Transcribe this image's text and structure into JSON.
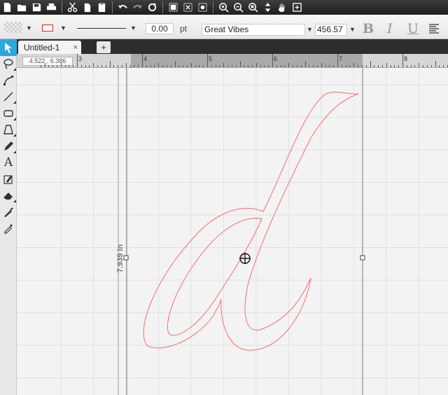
{
  "toolbar": {
    "icons": [
      "new-file",
      "open-folder",
      "save",
      "print",
      "cut",
      "copy",
      "paste",
      "undo",
      "redo",
      "refresh",
      "group",
      "ungroup",
      "select-all",
      "zoom-in",
      "zoom-out",
      "zoom-fit",
      "move",
      "pan-hand",
      "fit-page"
    ]
  },
  "properties": {
    "stroke_width": "0.00",
    "stroke_unit": "pt",
    "font_name": "Great Vibes",
    "font_size": "456.57",
    "bold": "B",
    "italic": "I",
    "underline": "U",
    "stroke_color": "#dd2222"
  },
  "tabs": {
    "doc_title": "Untitled-1",
    "close": "×",
    "add": "+"
  },
  "ruler": {
    "coords": "4.522 , 6.386",
    "labels": [
      "3",
      "4",
      "5",
      "6",
      "7",
      "8"
    ]
  },
  "canvas": {
    "height_label": "7.939 in",
    "glyph": "d",
    "glyph_color": "#ff6b6b"
  }
}
